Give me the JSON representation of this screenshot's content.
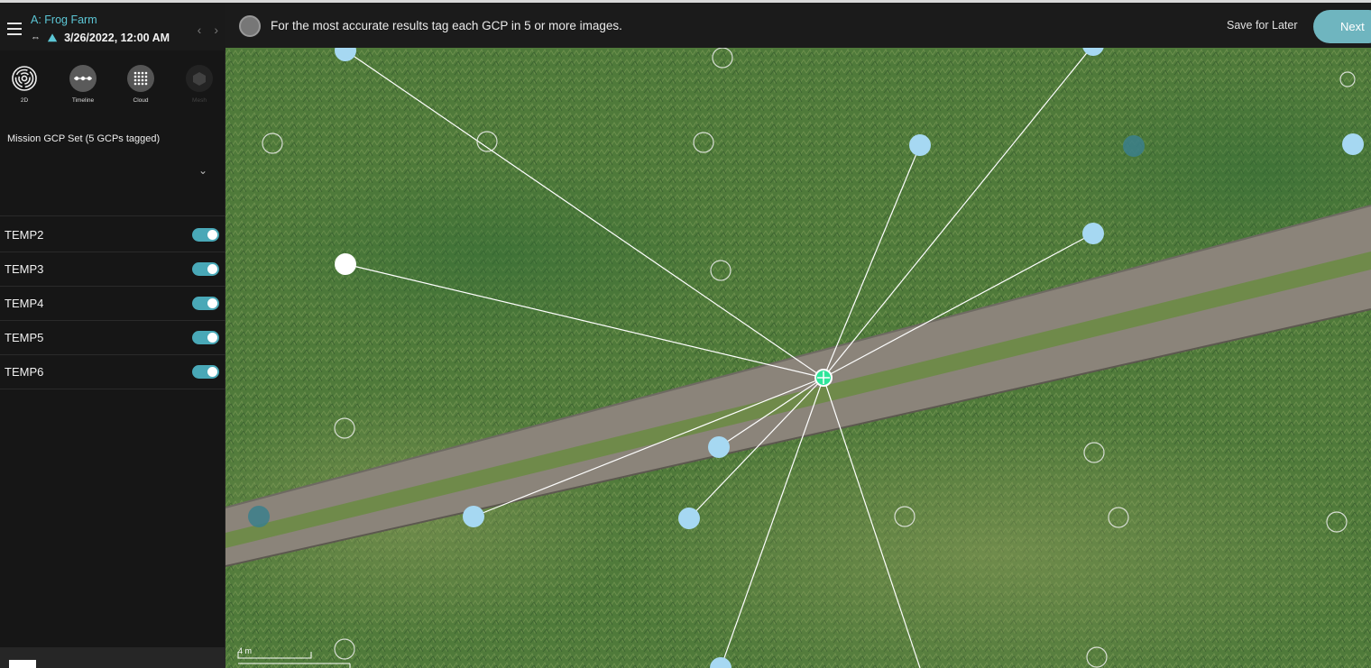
{
  "header": {
    "project": "A: Frog Farm",
    "date": "3/26/2022, 12:00 AM"
  },
  "view_tabs": [
    {
      "label": "2D",
      "icon": "fingerprint-icon"
    },
    {
      "label": "Timeline",
      "icon": "timeline-icon"
    },
    {
      "label": "Cloud",
      "icon": "point-cloud-icon"
    },
    {
      "label": "Mesh",
      "icon": "mesh-cube-icon"
    }
  ],
  "gcp_set": {
    "label": "Mission GCP Set (5 GCPs tagged)"
  },
  "gcps": [
    {
      "name": "TEMP2",
      "enabled": true
    },
    {
      "name": "TEMP3",
      "enabled": true
    },
    {
      "name": "TEMP4",
      "enabled": true
    },
    {
      "name": "TEMP5",
      "enabled": true
    },
    {
      "name": "TEMP6",
      "enabled": true
    }
  ],
  "topbar": {
    "banner": "For the most accurate results tag each GCP in 5 or more images.",
    "save_later": "Save for Later",
    "next": "Next"
  },
  "map": {
    "scale_label": "4 m"
  },
  "colors": {
    "accent": "#5cc7d6",
    "toggle_on": "#49a8b7",
    "next_button": "#6fb5bf",
    "tagged_point": "#a6d8f2",
    "target_point": "#2ee59a"
  }
}
